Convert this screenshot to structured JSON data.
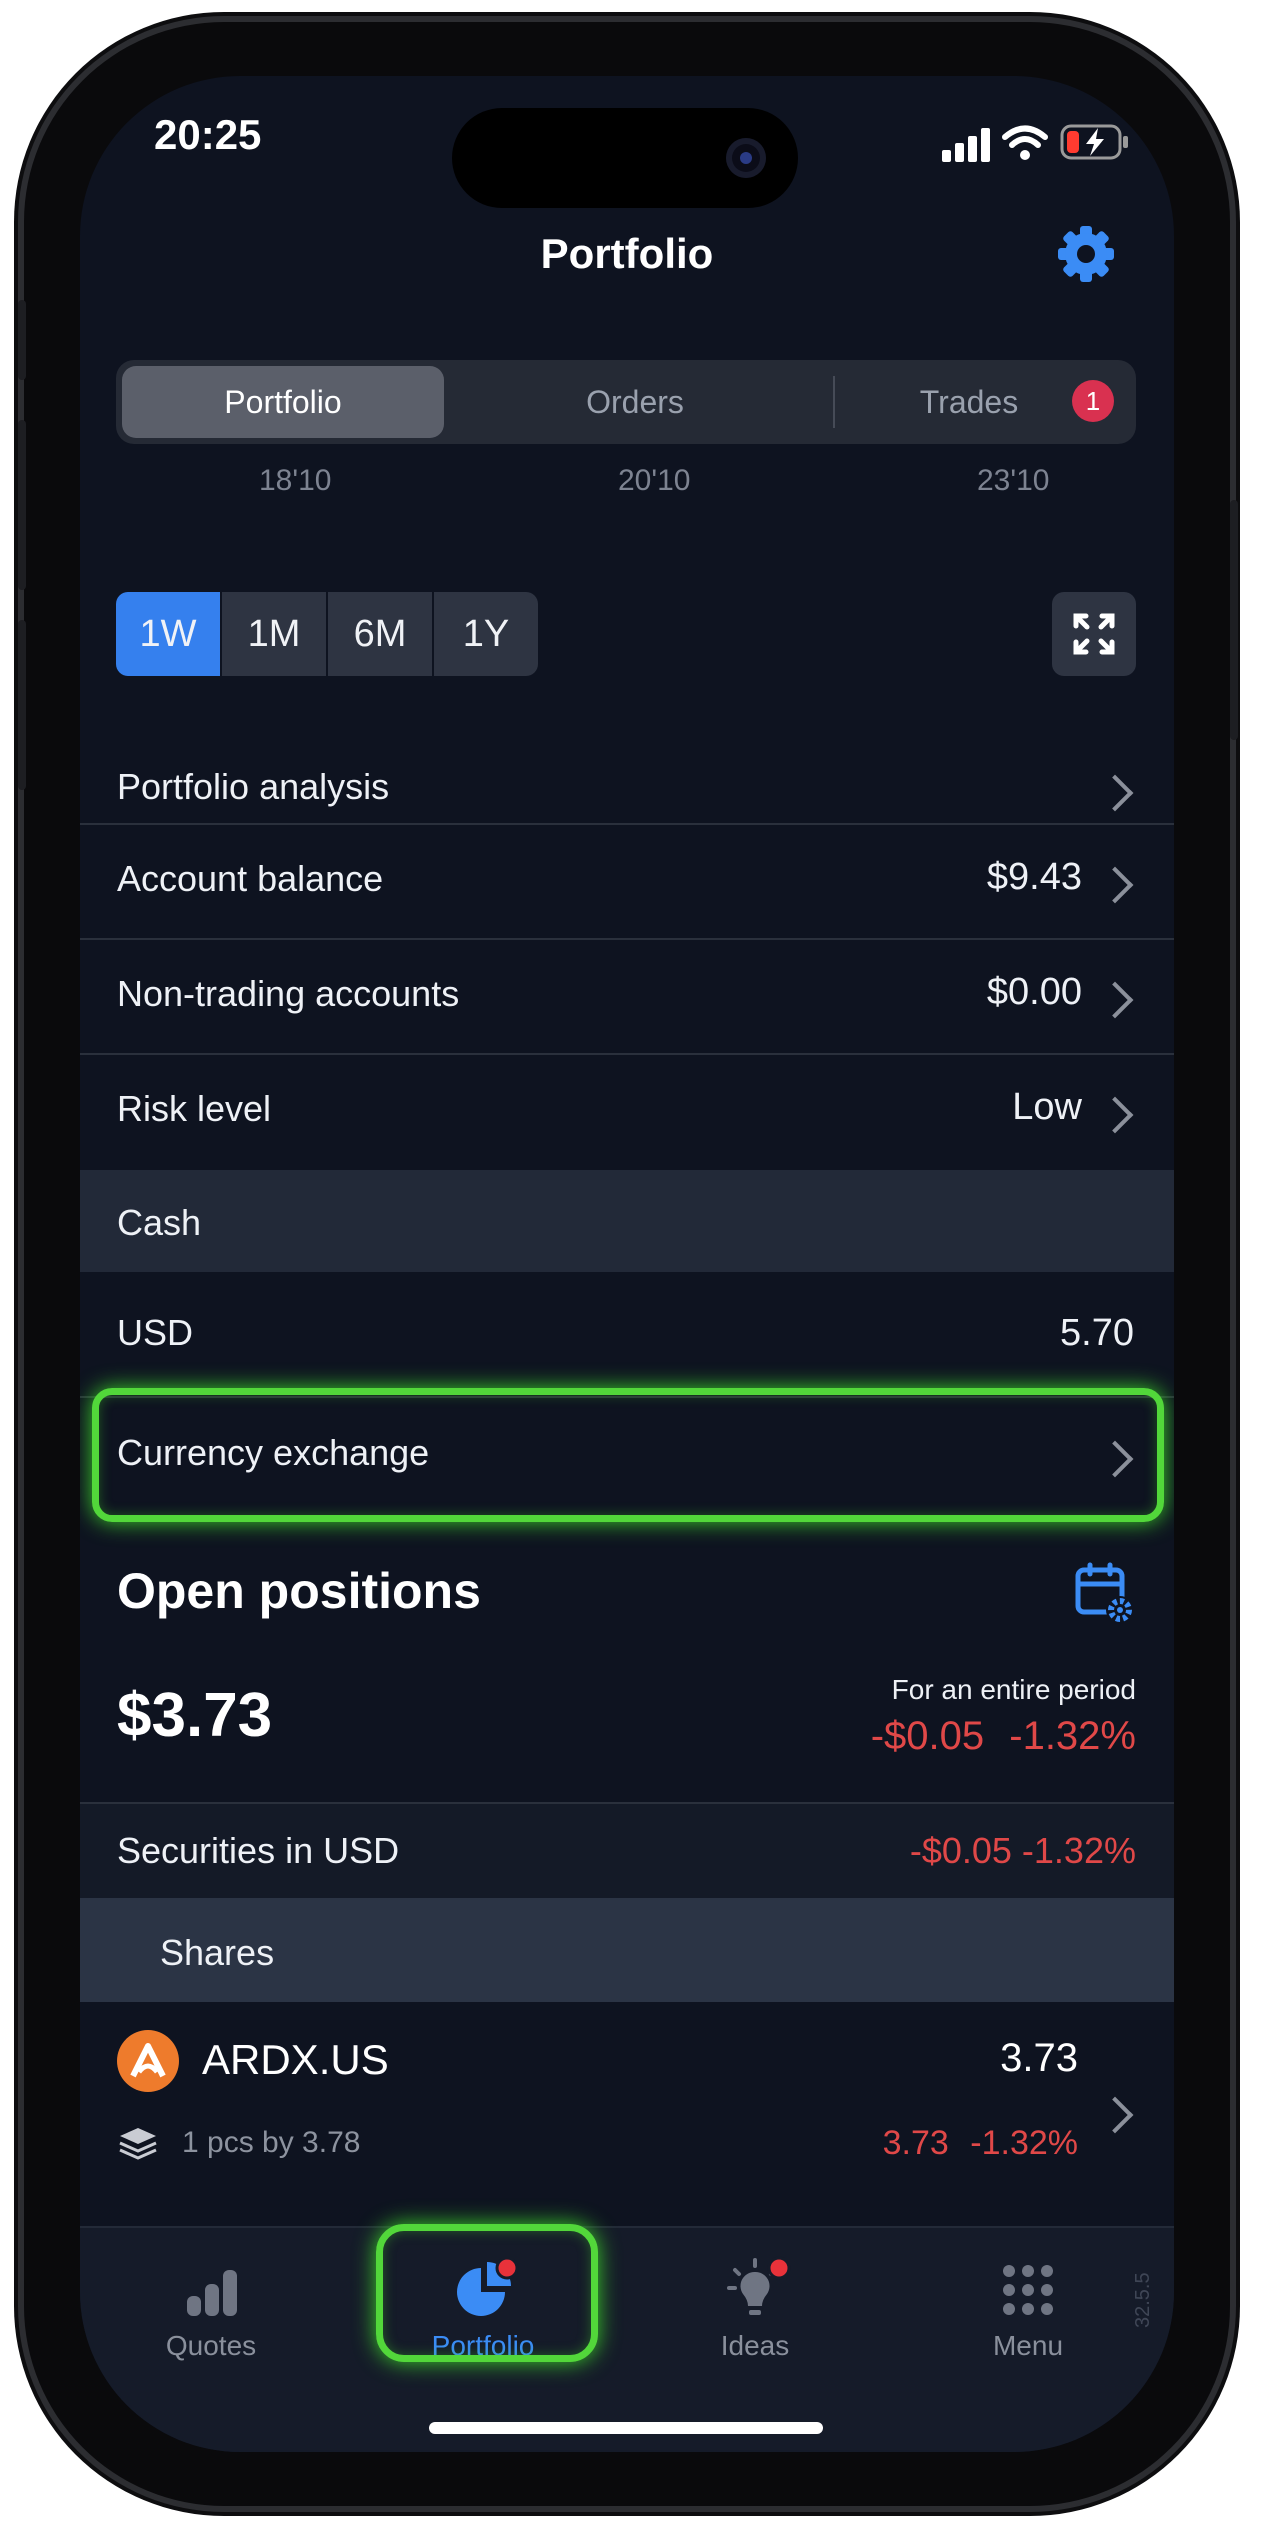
{
  "status_bar": {
    "time": "20:25"
  },
  "header": {
    "title": "Portfolio"
  },
  "segments": {
    "items": [
      "Portfolio",
      "Orders",
      "Trades"
    ],
    "active": "Portfolio",
    "trades_badge": "1"
  },
  "chart_dates": [
    "18'10",
    "20'10",
    "23'10"
  ],
  "ranges": {
    "items": [
      "1W",
      "1M",
      "6M",
      "1Y"
    ],
    "active": "1W"
  },
  "rows": {
    "portfolio_analysis": "Portfolio analysis",
    "account_balance": {
      "label": "Account balance",
      "value": "$9.43"
    },
    "non_trading": {
      "label": "Non-trading accounts",
      "value": "$0.00"
    },
    "risk": {
      "label": "Risk level",
      "value": "Low"
    }
  },
  "cash": {
    "title": "Cash",
    "usd_label": "USD",
    "usd_value": "5.70",
    "currency_exchange": "Currency exchange"
  },
  "open_positions": {
    "title": "Open positions",
    "total": "$3.73",
    "period_label": "For an entire period",
    "period_change": "-$0.05",
    "period_pct": "-1.32%",
    "securities_label": "Securities in USD",
    "securities_change": "-$0.05 -1.32%",
    "shares_title": "Shares",
    "position": {
      "ticker": "ARDX.US",
      "value": "3.73",
      "qty": "1 pcs by 3.78",
      "price": "3.73",
      "pct": "-1.32%"
    }
  },
  "tabbar": {
    "items": [
      "Quotes",
      "Portfolio",
      "Ideas",
      "Menu"
    ],
    "active": "Portfolio",
    "version": "32.5.5"
  },
  "colors": {
    "accent": "#3580ee",
    "negative": "#e04848",
    "highlight": "#52d73a",
    "badge": "#d93150",
    "background": "#0e1320"
  }
}
